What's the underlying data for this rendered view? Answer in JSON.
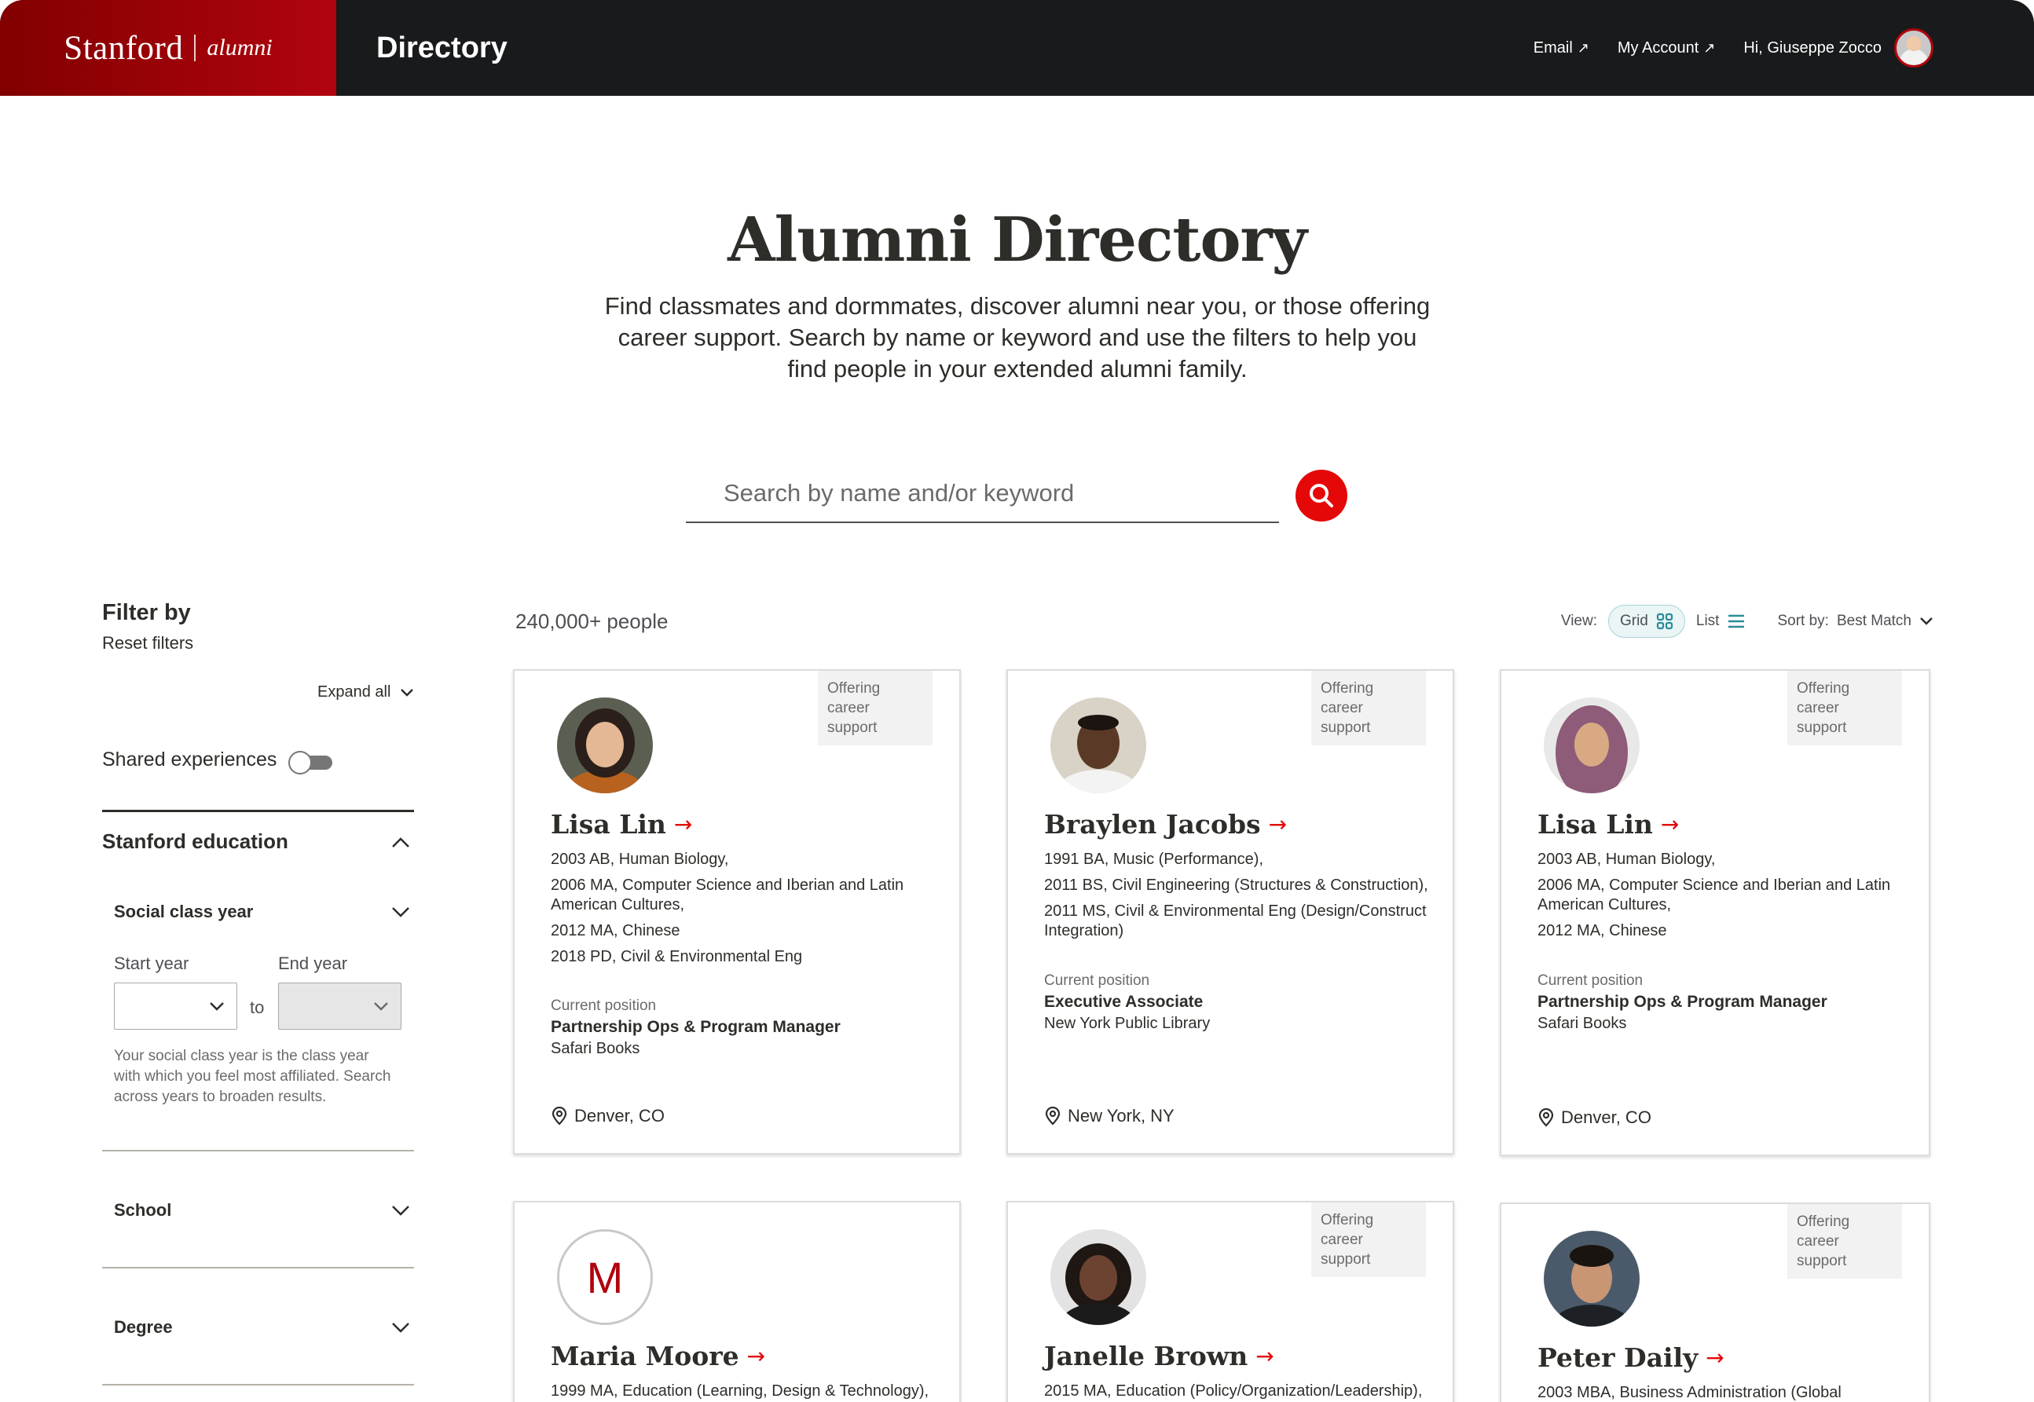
{
  "header": {
    "brand_primary": "Stanford",
    "brand_secondary": "alumni",
    "app_title": "Directory",
    "nav": {
      "email": "Email",
      "account": "My Account",
      "greeting": "Hi, Giuseppe Zocco"
    }
  },
  "hero": {
    "title": "Alumni Directory",
    "subtitle": "Find classmates and dormmates, discover alumni near you, or those offering career support. Search by name or keyword and use the filters to help you find people in your extended alumni family."
  },
  "search": {
    "placeholder": "Search by name and/or keyword",
    "value": ""
  },
  "sidebar": {
    "title": "Filter by",
    "reset": "Reset filters",
    "expand_all": "Expand all",
    "shared_experiences": "Shared experiences",
    "sections": {
      "education": "Stanford education",
      "class_year": "Social class year",
      "start_year": "Start year",
      "end_year": "End year",
      "to": "to",
      "help": "Your social class year is the class year with which you feel most affiliated. Search across years to broaden results.",
      "school": "School",
      "degree": "Degree"
    }
  },
  "results": {
    "count": "240,000+ people",
    "view_label": "View:",
    "grid_label": "Grid",
    "list_label": "List",
    "sort_label": "Sort by:",
    "sort_value": "Best Match"
  },
  "cards": [
    {
      "name": "Lisa Lin",
      "badge": "Offering career support",
      "degrees": [
        "2003 AB, Human Biology,",
        "2006 MA, Computer Science and Iberian and Latin American Cultures,",
        "2012 MA, Chinese",
        "2018 PD, Civil & Environmental Eng"
      ],
      "position_label": "Current position",
      "position_title": "Partnership Ops & Program Manager",
      "position_org": "Safari Books",
      "location": "Denver, CO"
    },
    {
      "name": "Braylen Jacobs",
      "badge": "Offering career support",
      "degrees": [
        "1991 BA, Music (Performance),",
        "2011 BS, Civil Engineering (Structures & Construction),",
        "2011 MS, Civil & Environmental Eng (Design/Construct Integration)"
      ],
      "position_label": "Current position",
      "position_title": "Executive Associate",
      "position_org": "New York Public Library",
      "location": "New York, NY"
    },
    {
      "name": "Lisa Lin",
      "badge": "Offering career support",
      "degrees": [
        "2003 AB, Human Biology,",
        "2006 MA, Computer Science and Iberian and Latin American Cultures,",
        "2012 MA, Chinese"
      ],
      "position_label": "Current position",
      "position_title": "Partnership Ops & Program Manager",
      "position_org": "Safari Books",
      "location": "Denver, CO"
    },
    {
      "name": "Maria Moore",
      "initial": "M",
      "degrees": [
        "1999 MA, Education (Learning, Design & Technology),"
      ]
    },
    {
      "name": "Janelle Brown",
      "badge": "Offering career support",
      "degrees": [
        "2015 MA, Education (Policy/Organization/Leadership),"
      ]
    },
    {
      "name": "Peter Daily",
      "badge": "Offering career support",
      "degrees": [
        "2003 MBA, Business Administration (Global"
      ]
    }
  ],
  "colors": {
    "brand_red": "#b1040e",
    "accent_red": "#e50808",
    "header_bg": "#181a1b",
    "teal": "#2b8c99"
  }
}
